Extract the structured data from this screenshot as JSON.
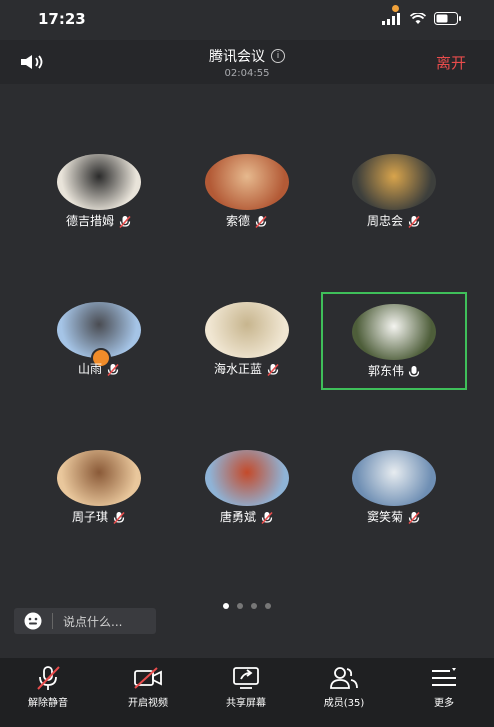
{
  "status_bar": {
    "time": "17:23"
  },
  "header": {
    "title": "腾讯会议",
    "duration": "02:04:55",
    "leave_label": "离开"
  },
  "participants": [
    {
      "name": "德吉措姆",
      "mic": "muted",
      "colors": [
        "#e9e4da",
        "#2b2b2b"
      ]
    },
    {
      "name": "索德",
      "mic": "muted",
      "colors": [
        "#b35a36",
        "#e6b98e"
      ]
    },
    {
      "name": "周忠会",
      "mic": "muted",
      "colors": [
        "#3d3f3c",
        "#d8a44c"
      ]
    },
    {
      "name": "山雨",
      "mic": "muted",
      "host": true,
      "colors": [
        "#a5c4e6",
        "#4a4c52"
      ]
    },
    {
      "name": "海水正蓝",
      "mic": "muted",
      "colors": [
        "#f0e6d2",
        "#c7b58e"
      ]
    },
    {
      "name": "郭东伟",
      "mic": "on",
      "active": true,
      "colors": [
        "#4e5e3a",
        "#f4f4f0"
      ]
    },
    {
      "name": "周子琪",
      "mic": "muted",
      "colors": [
        "#e9c79c",
        "#8a5a38"
      ]
    },
    {
      "name": "唐勇斌",
      "mic": "muted",
      "colors": [
        "#8fb3d6",
        "#c44a2a"
      ]
    },
    {
      "name": "窦笑菊",
      "mic": "muted",
      "colors": [
        "#6f8fb4",
        "#e7ecf0"
      ]
    }
  ],
  "pager": {
    "count": 4,
    "active": 0
  },
  "chat": {
    "placeholder": "说点什么..."
  },
  "toolbar": {
    "unmute": "解除静音",
    "video": "开启视频",
    "share": "共享屏幕",
    "members": "成员(35)",
    "more": "更多"
  }
}
